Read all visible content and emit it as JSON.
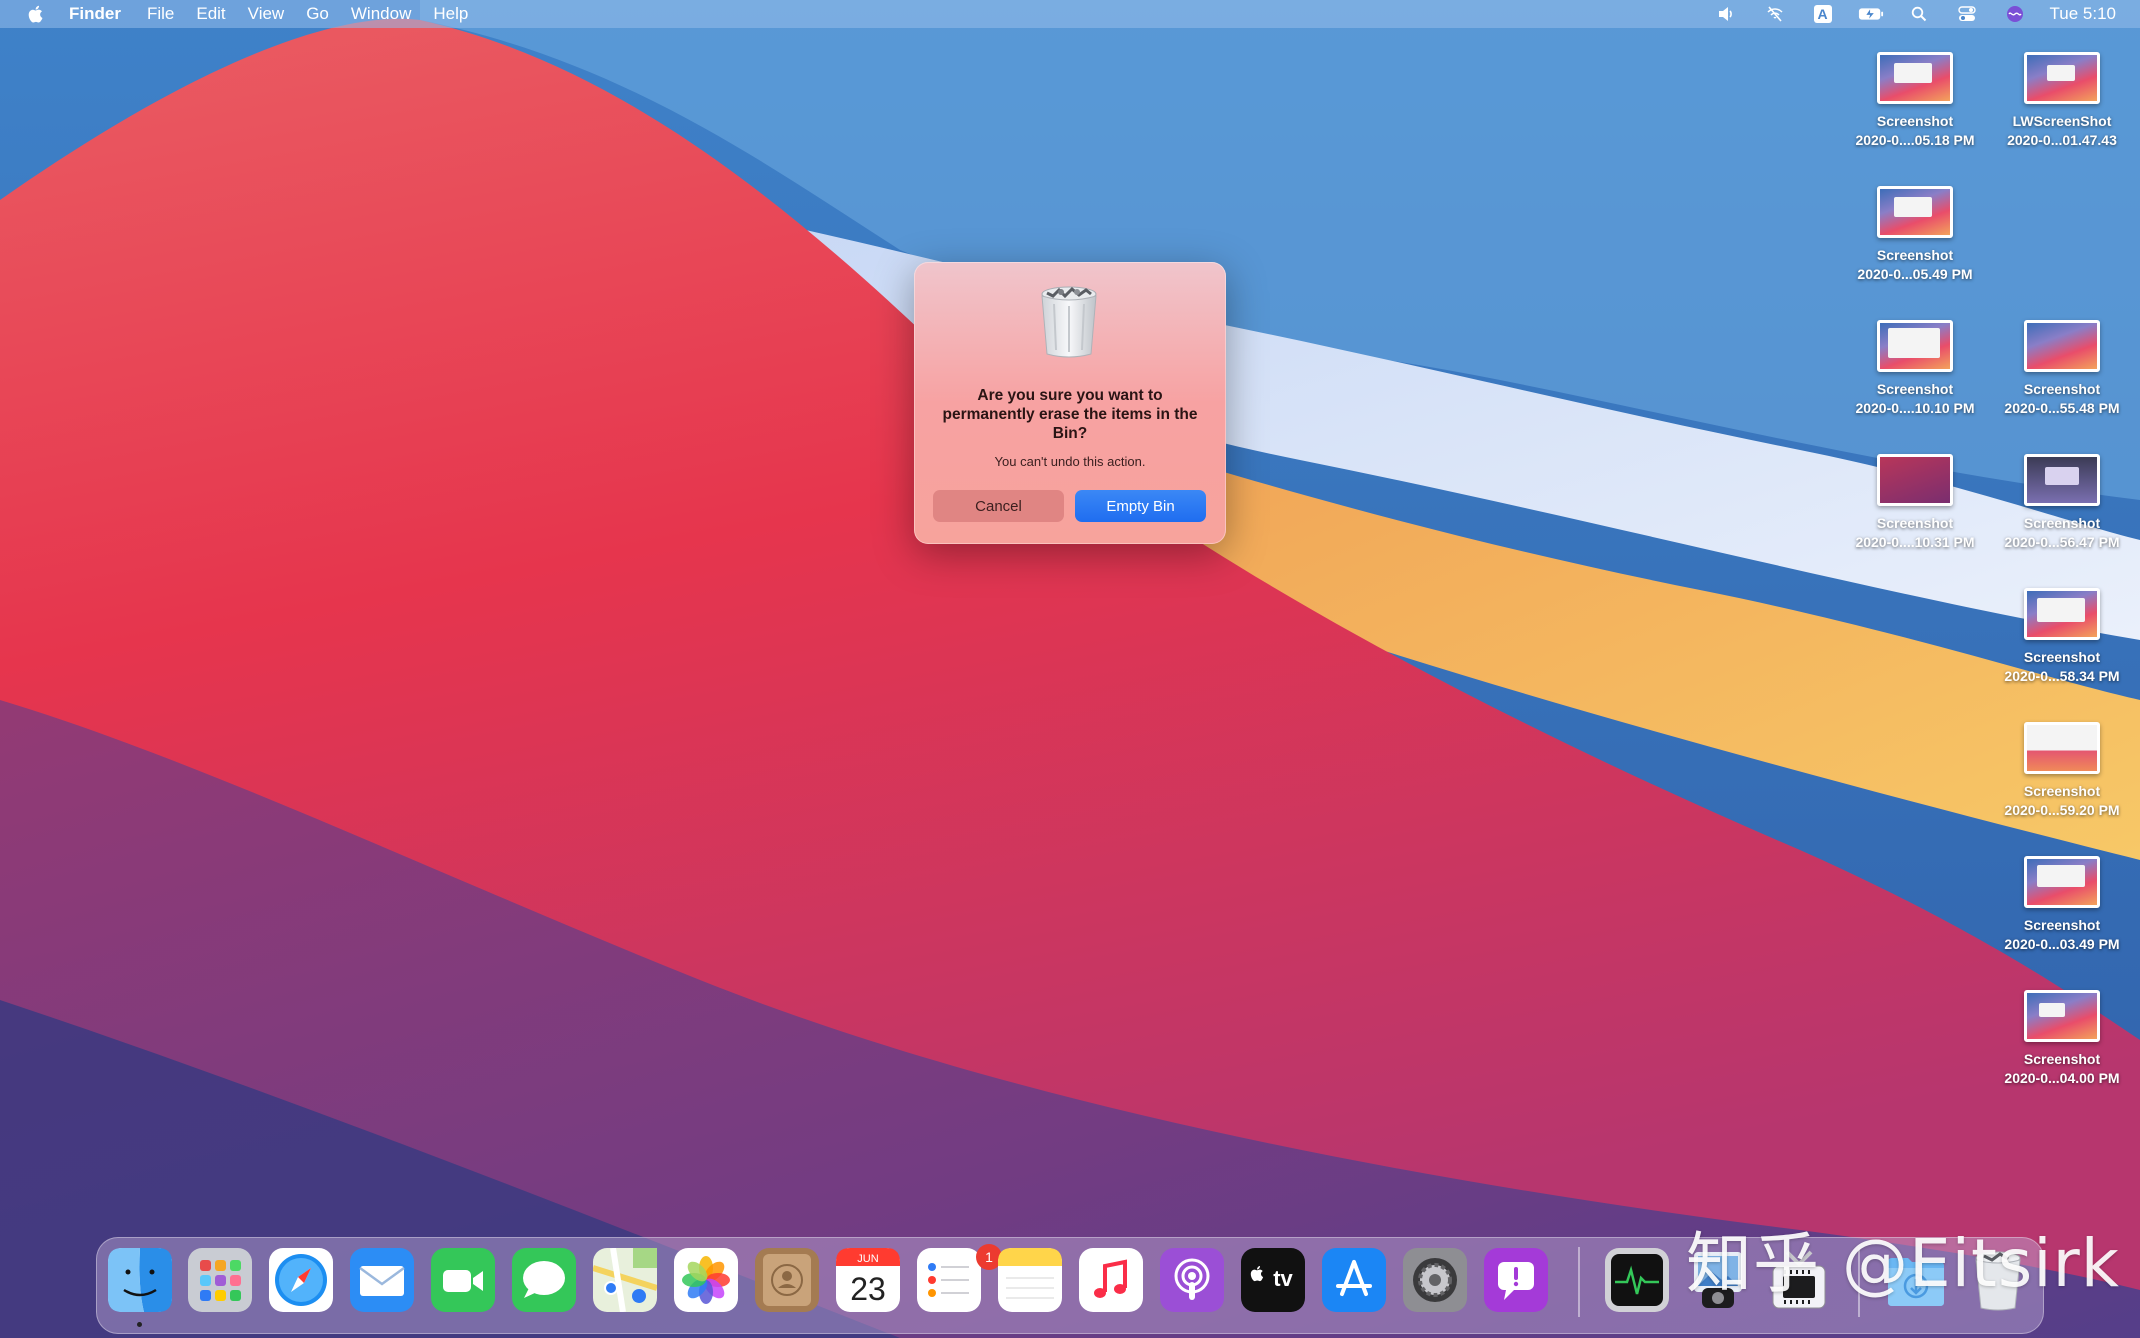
{
  "menubar": {
    "app": "Finder",
    "items": [
      "File",
      "Edit",
      "View",
      "Go",
      "Window",
      "Help"
    ],
    "clock": "Tue 5:10",
    "status_icons": [
      "volume-icon",
      "wifi-off-icon",
      "input-source-icon",
      "battery-icon",
      "spotlight-icon",
      "control-center-icon",
      "siri-icon"
    ],
    "input_letter": "A"
  },
  "desktop": {
    "icons": [
      {
        "line1": "Screenshot",
        "line2": "2020-0....05.18 PM"
      },
      {
        "line1": "LWScreenShot",
        "line2": "2020-0...01.47.43"
      },
      {
        "line1": "Screenshot",
        "line2": "2020-0...05.49 PM"
      },
      {
        "line1": "Screenshot",
        "line2": "2020-0....10.10 PM"
      },
      {
        "line1": "Screenshot",
        "line2": "2020-0...55.48 PM"
      },
      {
        "line1": "Screenshot",
        "line2": "2020-0....10.31 PM"
      },
      {
        "line1": "Screenshot",
        "line2": "2020-0...56.47 PM"
      },
      {
        "line1": "Screenshot",
        "line2": "2020-0...58.34 PM"
      },
      {
        "line1": "Screenshot",
        "line2": "2020-0...59.20 PM"
      },
      {
        "line1": "Screenshot",
        "line2": "2020-0...03.49 PM"
      },
      {
        "line1": "Screenshot",
        "line2": "2020-0...04.00 PM"
      }
    ]
  },
  "dialog": {
    "title": "Are you sure you want to permanently erase the items in the Bin?",
    "message": "You can't undo this action.",
    "cancel": "Cancel",
    "confirm": "Empty Bin"
  },
  "dock": {
    "calendar_month": "JUN",
    "calendar_day": "23",
    "reminders_badge": "1",
    "tv_label": "tv",
    "apps": [
      "finder-icon",
      "launchpad-icon",
      "safari-icon",
      "mail-icon",
      "facetime-icon",
      "messages-icon",
      "maps-icon",
      "photos-icon",
      "contacts-icon",
      "calendar-icon",
      "reminders-icon",
      "notes-icon",
      "music-icon",
      "podcasts-icon",
      "apple-tv-icon",
      "app-store-icon",
      "system-preferences-icon",
      "feedback-assistant-icon",
      "activity-monitor-icon",
      "preview-icon",
      "system-information-icon",
      "downloads-folder-icon",
      "trash-icon"
    ]
  },
  "watermark": "知乎 @Eitsirk",
  "colors": {
    "accent": "#1f6df0",
    "badge": "#ec3b30"
  }
}
